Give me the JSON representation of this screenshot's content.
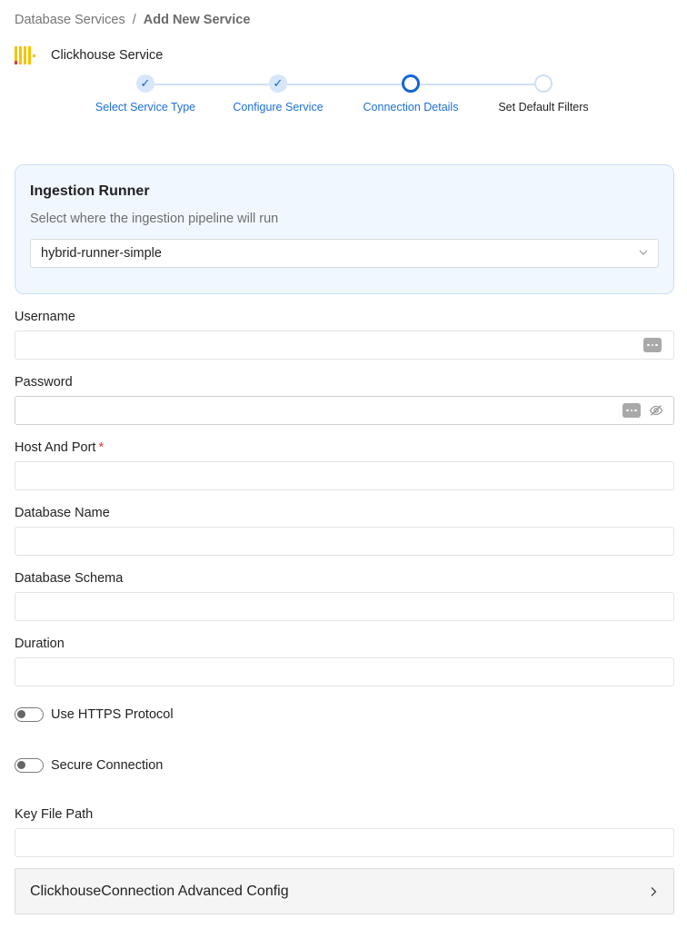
{
  "breadcrumb": {
    "root": "Database Services",
    "separator": "/",
    "current": "Add New Service"
  },
  "service": {
    "name": "Clickhouse Service",
    "logo_icon": "clickhouse-logo",
    "logo_color": "#f5c400"
  },
  "stepper": {
    "steps": [
      {
        "label": "Select Service Type",
        "status": "done"
      },
      {
        "label": "Configure Service",
        "status": "done"
      },
      {
        "label": "Connection Details",
        "status": "active"
      },
      {
        "label": "Set Default Filters",
        "status": "pending"
      }
    ],
    "check_glyph": "✓",
    "accent": "#1565d8"
  },
  "runner": {
    "title": "Ingestion Runner",
    "subtitle": "Select where the ingestion pipeline will run",
    "selected": "hybrid-runner-simple"
  },
  "fields": {
    "username": {
      "label": "Username",
      "value": ""
    },
    "password": {
      "label": "Password",
      "value": ""
    },
    "host_port": {
      "label": "Host And Port",
      "required_mark": "*",
      "value": ""
    },
    "database_name": {
      "label": "Database Name",
      "value": ""
    },
    "database_schema": {
      "label": "Database Schema",
      "value": ""
    },
    "duration": {
      "label": "Duration",
      "value": ""
    },
    "key_file_path": {
      "label": "Key File Path",
      "value": ""
    }
  },
  "toggles": {
    "https": {
      "label": "Use HTTPS Protocol",
      "on": false
    },
    "secure": {
      "label": "Secure Connection",
      "on": false
    }
  },
  "advanced": {
    "label": "ClickhouseConnection Advanced Config"
  }
}
